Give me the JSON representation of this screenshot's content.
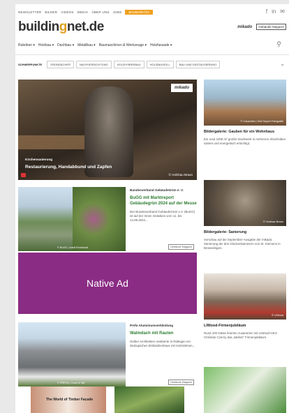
{
  "topbar": {
    "links": [
      "NEWSLETTER",
      "BILDER",
      "VIDEOS",
      "MEDIA",
      "ÜBER UNS",
      "JOBS"
    ],
    "badge": "BAUMARKT24",
    "social": [
      "f",
      "in",
      "✉"
    ]
  },
  "logo": {
    "part1": "buildin",
    "g": "g",
    "part2": "net.de"
  },
  "brands": {
    "mikado": "mikado",
    "gebaeude": "Gebäude Magazin"
  },
  "nav": {
    "items": [
      "Rubriken ▾",
      "Holzbau ▾",
      "Dachbau ▾",
      "Metallbau ▾",
      "Baumaschinen & Werkzeuge ▾",
      "Holzfassade ▾"
    ],
    "search_icon": "⚲"
  },
  "pills": {
    "items": [
      "SCHWERPUNKTE",
      "GRÜNDÄCHER",
      "NACHVERDICHTUNG",
      "HOLZHYBRIDBAU",
      "HOLZBAUSOLL",
      "BAU UND DIGITALISIERUNG"
    ],
    "chevron": "⌄"
  },
  "hero": {
    "badge": "mikado",
    "kicker": "Kirchensanierung",
    "title": "Restaurierung, Handabbund und Zapfen",
    "credit": "© Holzbau Braun"
  },
  "right_cards": [
    {
      "title": "Bildergalerie: Gauben für ein Wohnhaus",
      "text": "Ein rund 1000 m² großer Dachwerk in mehreren Abschnitten saniert und energetisch ertüchtigt.",
      "credit": "© Carpenter | Olaf Hopert Fotografie"
    },
    {
      "title": "Bildergalerie: Sanierung",
      "text": "Vorschau auf die September-Ausgabe der mikado: Sanierung der drei Glockenkammern von St. Kiemens in Brüsselingen.",
      "credit": "© Holzbau Braun"
    },
    {
      "title": "LIWood-Firmenjubiläum",
      "text": "Rund 100 Gäste feierten zusammen mit LIWood-CEO Christian Czerny das „Meilen“ Firmenjubiläum.",
      "credit": "© LIWood"
    }
  ],
  "article1": {
    "kicker": "Bundesverband GebäudeGrün e. V.",
    "title": "BuGG mit Marktreport Gebäudegrün 2024 auf der Messe",
    "text": "Der Bundesverband GebäudeGrün e.V. (BuGG) ist auf der Innen Gelaskes vom 11. bis 14.09.2024...",
    "credit": "© BuGG | Adolf Ehrlichauf",
    "srclogo": "Gebäude Magazin"
  },
  "nativead": {
    "label": "Native Ad"
  },
  "article2": {
    "kicker": "Prefa Aluminiumverkleidung",
    "title": "Walmdach mit Rauten",
    "text": "Gelber Architekten realisierte in Ratingen ein ökologisches Einfamilienhaus mit Holzrahmen...",
    "credit": "© PREFA | Croce & Wir",
    "srclogo": "Gebäude Magazin"
  },
  "bottom": {
    "teaser": "The World of Timber Facade"
  },
  "colors": {
    "accent_orange": "#f0a020",
    "native_ad": "#8a2c84",
    "green_title": "#2e7d32"
  }
}
